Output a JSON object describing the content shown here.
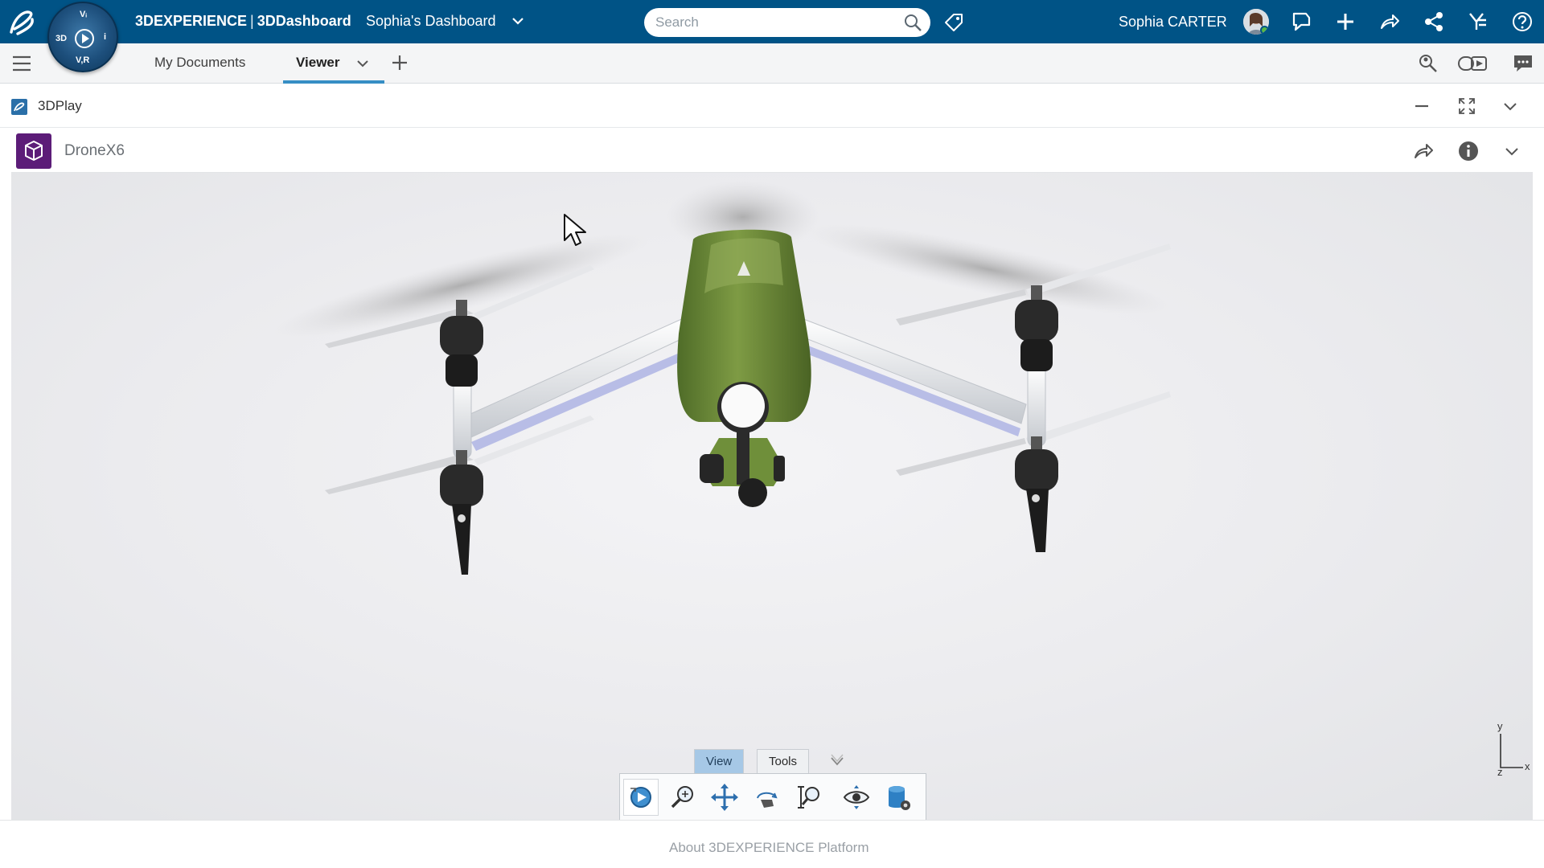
{
  "topbar": {
    "brand_prefix": "3DEXPERIENCE",
    "brand_app": "3DDashboard",
    "dashboard_name": "Sophia's Dashboard",
    "compass": {
      "top": "Vᵢ",
      "left": "3D",
      "right": "i",
      "bottom": "V,R"
    },
    "search_placeholder": "Search",
    "user_name": "Sophia CARTER",
    "icons": [
      "ds-logo-icon",
      "compass-icon",
      "chevron-down-icon",
      "search-icon",
      "tag-icon",
      "avatar",
      "feed-icon",
      "plus-icon",
      "share-icon",
      "collaborate-icon",
      "apps-icon",
      "help-icon"
    ]
  },
  "tabs": {
    "items": [
      {
        "label": "My Documents",
        "active": false
      },
      {
        "label": "Viewer",
        "active": true
      }
    ],
    "icons": [
      "menu-icon",
      "chevron-down-icon",
      "plus-icon",
      "search-people-icon",
      "3d-toggle-icon",
      "chat-icon"
    ]
  },
  "widget": {
    "title": "3DPlay",
    "icons": [
      "minimize-icon",
      "fullscreen-icon",
      "chevron-down-icon"
    ]
  },
  "object": {
    "title": "DroneX6",
    "icons": [
      "cube-icon",
      "share-icon",
      "info-icon",
      "chevron-down-icon"
    ]
  },
  "viewer": {
    "toolbar_tabs": [
      {
        "label": "View",
        "active": true
      },
      {
        "label": "Tools",
        "active": false
      }
    ],
    "actions": [
      "play-view-icon",
      "zoom-icon",
      "pan-icon",
      "rotate-hand-icon",
      "zoom-area-icon",
      "look-at-icon",
      "database-icon"
    ],
    "axis_labels": {
      "y": "y",
      "x": "x",
      "z": "z"
    }
  },
  "colors": {
    "topbar": "#005386",
    "accent": "#368ec4",
    "object_icon": "#5c1c78",
    "drone_body": "#6f8f3a"
  },
  "footer": {
    "link": "About 3DEXPERIENCE Platform"
  }
}
